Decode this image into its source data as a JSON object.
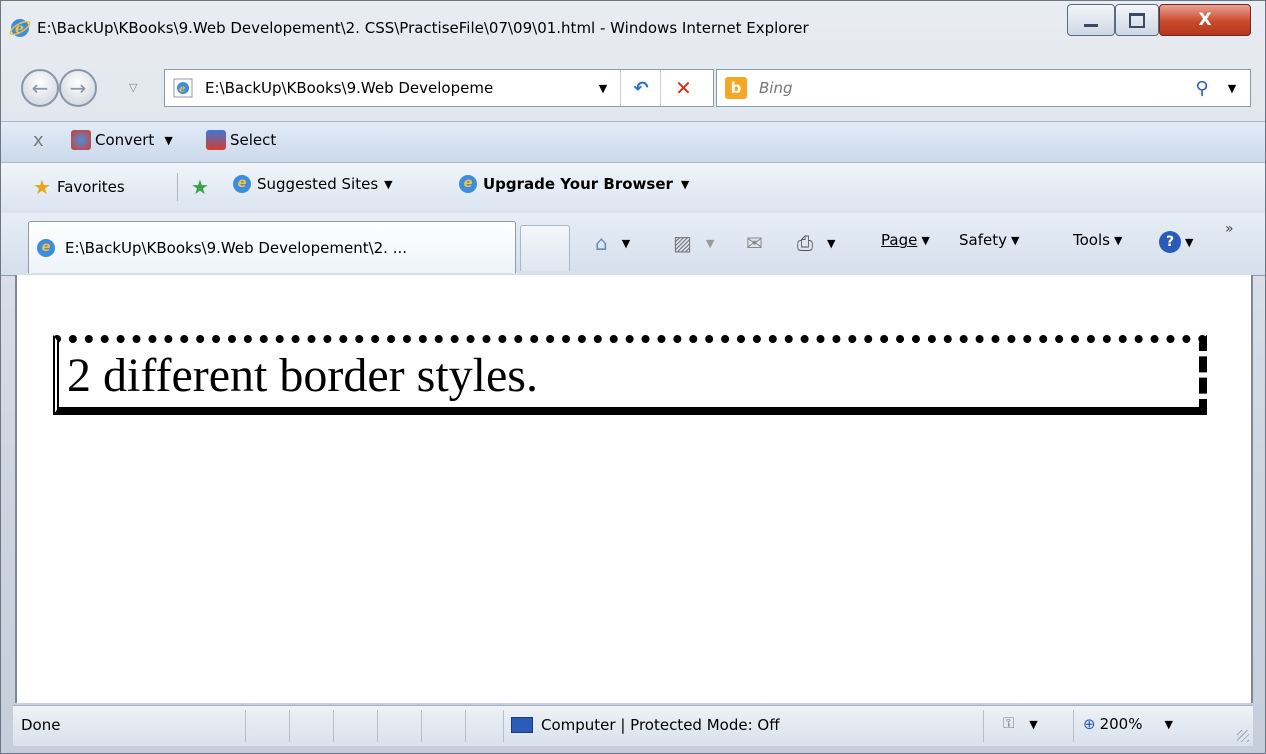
{
  "window": {
    "title": "E:\\BackUp\\KBooks\\9.Web Developement\\2. CSS\\PractiseFile\\07\\09\\01.html - Windows Internet Explorer",
    "minimize_glyph": "▁",
    "maximize_glyph": "□",
    "close_glyph": "X"
  },
  "navigation": {
    "address": "E:\\BackUp\\KBooks\\9.Web Developeme",
    "search_placeholder": "Bing",
    "refresh_glyph": "↶",
    "stop_glyph": "✕"
  },
  "convert_toolbar": {
    "close_glyph": "x",
    "convert_label": "Convert",
    "select_label": "Select"
  },
  "favorites_bar": {
    "favorites_label": "Favorites",
    "suggested_label": "Suggested Sites",
    "upgrade_label": "Upgrade Your Browser"
  },
  "tabs": {
    "active_title": "E:\\BackUp\\KBooks\\9.Web Developement\\2. ..."
  },
  "command_bar": {
    "page_label": "Page",
    "safety_label": "Safety",
    "tools_label": "Tools"
  },
  "content": {
    "text": "2 different border styles."
  },
  "status_bar": {
    "status_text": "Done",
    "zone_text": "Computer | Protected Mode: Off",
    "zoom_text": "200%"
  },
  "colors": {
    "accent": "#3c8de0",
    "close_button": "#c94a2c",
    "bing": "#f5a623"
  },
  "icons": [
    "ie-icon",
    "back-icon",
    "forward-icon",
    "refresh-icon",
    "stop-icon",
    "bing-icon",
    "search-icon",
    "star-icon",
    "home-icon",
    "rss-icon",
    "mail-icon",
    "print-icon",
    "help-icon",
    "computer-icon",
    "zoom-icon"
  ]
}
